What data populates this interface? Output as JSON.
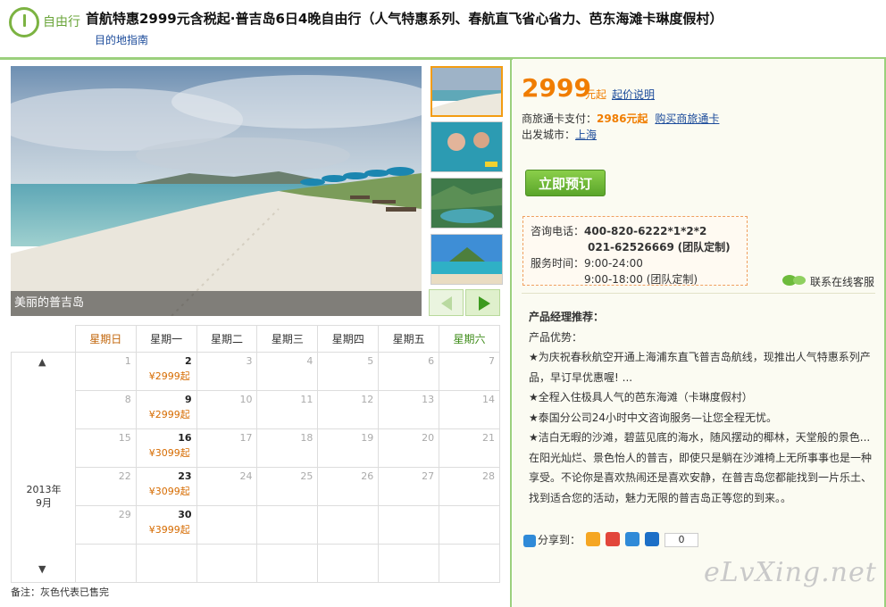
{
  "header": {
    "tag": "自由行",
    "title": "首航特惠2999元含税起·普吉岛6日4晚自由行（人气特惠系列、春航直飞省心省力、芭东海滩卡琳度假村）",
    "guide_link": "目的地指南"
  },
  "gallery": {
    "caption": "美丽的普吉岛"
  },
  "calendar": {
    "weekdays": [
      "星期日",
      "星期一",
      "星期二",
      "星期三",
      "星期四",
      "星期五",
      "星期六"
    ],
    "year_month": [
      "2013年",
      "9月"
    ],
    "rows": [
      [
        {
          "d": "1"
        },
        {
          "d": "2",
          "p": "¥2999起"
        },
        {
          "d": "3"
        },
        {
          "d": "4"
        },
        {
          "d": "5"
        },
        {
          "d": "6"
        },
        {
          "d": "7"
        }
      ],
      [
        {
          "d": "8"
        },
        {
          "d": "9",
          "p": "¥2999起"
        },
        {
          "d": "10"
        },
        {
          "d": "11"
        },
        {
          "d": "12"
        },
        {
          "d": "13"
        },
        {
          "d": "14"
        }
      ],
      [
        {
          "d": "15"
        },
        {
          "d": "16",
          "p": "¥3099起"
        },
        {
          "d": "17"
        },
        {
          "d": "18"
        },
        {
          "d": "19"
        },
        {
          "d": "20"
        },
        {
          "d": "21"
        }
      ],
      [
        {
          "d": "22"
        },
        {
          "d": "23",
          "p": "¥3099起"
        },
        {
          "d": "24"
        },
        {
          "d": "25"
        },
        {
          "d": "26"
        },
        {
          "d": "27"
        },
        {
          "d": "28"
        }
      ],
      [
        {
          "d": "29"
        },
        {
          "d": "30",
          "p": "¥3999起"
        },
        {
          "d": ""
        },
        {
          "d": ""
        },
        {
          "d": ""
        },
        {
          "d": ""
        },
        {
          "d": ""
        }
      ],
      [
        {
          "d": ""
        },
        {
          "d": ""
        },
        {
          "d": ""
        },
        {
          "d": ""
        },
        {
          "d": ""
        },
        {
          "d": ""
        },
        {
          "d": ""
        }
      ]
    ],
    "note": "备注：灰色代表已售完",
    "up_arrow": "▲",
    "down_arrow": "▼"
  },
  "pricing": {
    "price": "2999",
    "unit": "元起",
    "explain_link": "起价说明",
    "card_label": "商旅通卡支付：",
    "card_price": "2986元起",
    "card_link": "购买商旅通卡",
    "city_label": "出发城市：",
    "city_link": "上海",
    "book_button": "立即预订"
  },
  "consult": {
    "phone_label": "咨询电话：",
    "phone1": "400-820-6222*1*2*2",
    "phone2": "021-62526669",
    "team1": "(团队定制)",
    "hours_label": "服务时间：",
    "hours1": "9:00-24:00",
    "hours2": "9:00-18:00",
    "team2": "(团队定制)",
    "online": "联系在线客服"
  },
  "recommend": {
    "heading": "产品经理推荐：",
    "sub": "产品优势：",
    "lines": [
      "★为庆祝春秋航空开通上海浦东直飞普吉岛航线，现推出人气特惠系列产品，早订早优惠喔! ...",
      "★全程入住极具人气的芭东海滩（卡琳度假村）",
      "★泰国分公司24小时中文咨询服务—让您全程无忧。",
      "★洁白无暇的沙滩，碧蓝见底的海水，随风摆动的椰林，天堂般的景色...  在阳光灿烂、景色怡人的普吉，即使只是躺在沙滩椅上无所事事也是一种享受。不论你是喜欢热闹还是喜欢安静，在普吉岛您都能找到一片乐土、找到适合您的活动，魅力无限的普吉岛正等您的到来。。"
    ]
  },
  "share": {
    "label": "分享到：",
    "count": "0",
    "icons": [
      "qzone-icon",
      "weibo-icon",
      "tencent-weibo-icon",
      "renren-icon"
    ],
    "colors": [
      "#f5a623",
      "#e2463b",
      "#2f8ad8",
      "#1c6fc7"
    ]
  },
  "watermark": "eLvXing.net"
}
